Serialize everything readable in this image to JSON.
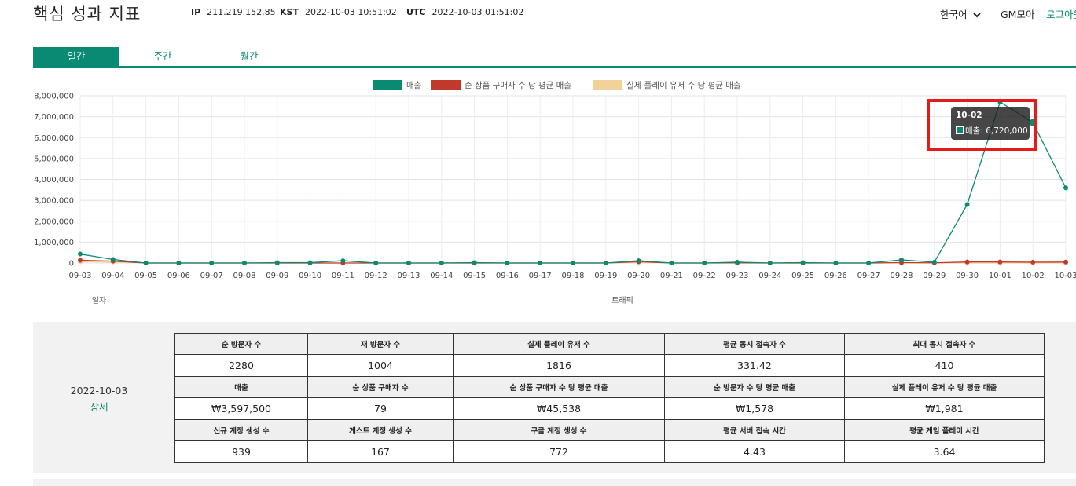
{
  "header": {
    "title": "핵심 성과 지표",
    "ip_label": "IP",
    "ip_value": "211.219.152.85",
    "kst_label": "KST",
    "kst_value": "2022-10-03 10:51:02",
    "utc_label": "UTC",
    "utc_value": "2022-10-03 01:51:02",
    "language": "한국어",
    "user": "GM모아",
    "logout": "로그아웃"
  },
  "tabs": [
    {
      "label": "일간",
      "active": true
    },
    {
      "label": "주간",
      "active": false
    },
    {
      "label": "월간",
      "active": false
    }
  ],
  "chart_data": {
    "type": "line",
    "x": [
      "09-03",
      "09-04",
      "09-05",
      "09-06",
      "09-07",
      "09-08",
      "09-09",
      "09-10",
      "09-11",
      "09-12",
      "09-13",
      "09-14",
      "09-15",
      "09-16",
      "09-17",
      "09-18",
      "09-19",
      "09-20",
      "09-21",
      "09-22",
      "09-23",
      "09-24",
      "09-25",
      "09-26",
      "09-27",
      "09-28",
      "09-29",
      "09-30",
      "10-01",
      "10-02",
      "10-03"
    ],
    "ylim": [
      0,
      8000000
    ],
    "yticks": [
      "0",
      "1,000,000",
      "2,000,000",
      "3,000,000",
      "4,000,000",
      "5,000,000",
      "6,000,000",
      "7,000,000",
      "8,000,000"
    ],
    "legend_position": "top-center",
    "grid": true,
    "series": [
      {
        "name": "매출",
        "color": "#0a8a73",
        "values": [
          430000,
          170000,
          0,
          0,
          0,
          0,
          20000,
          20000,
          110000,
          0,
          0,
          0,
          20000,
          0,
          0,
          0,
          0,
          110000,
          0,
          0,
          40000,
          0,
          20000,
          0,
          0,
          150000,
          40000,
          2800000,
          7700000,
          6720000,
          3597500
        ]
      },
      {
        "name": "순 상품 구매자 수 당 평균 매출",
        "color": "#c0392b",
        "values": [
          130000,
          90000,
          0,
          0,
          0,
          0,
          0,
          0,
          0,
          0,
          0,
          0,
          0,
          0,
          0,
          0,
          0,
          60000,
          0,
          0,
          10000,
          0,
          0,
          0,
          0,
          20000,
          10000,
          50000,
          50000,
          40000,
          45538
        ]
      },
      {
        "name": "실제 플레이 유저 수 당 평균 매출",
        "color": "#f2d29b",
        "values": [
          60000,
          50000,
          0,
          0,
          0,
          0,
          0,
          0,
          0,
          0,
          0,
          0,
          0,
          0,
          0,
          0,
          0,
          30000,
          0,
          0,
          0,
          0,
          0,
          0,
          0,
          0,
          0,
          0,
          0,
          0,
          1981
        ]
      }
    ],
    "tooltip": {
      "title": "10-02",
      "line": "매출: 6,720,000"
    },
    "footer_left": "일자",
    "footer_center": "트래픽"
  },
  "summary": {
    "date": "2022-10-03",
    "detail_link": "상세",
    "rows": [
      {
        "headers": [
          "순 방문자 수",
          "재 방문자 수",
          "실제 플레이 유저 수",
          "평균 동시 접속자 수",
          "최대 동시 접속자 수"
        ],
        "values": [
          "2280",
          "1004",
          "1816",
          "331.42",
          "410"
        ]
      },
      {
        "headers": [
          "매출",
          "순 상품 구매자 수",
          "순 상품 구매자 수 당 평균 매출",
          "순 방문자 수 당 평균 매출",
          "실제 플레이 유저 수 당 평균 매출"
        ],
        "values": [
          "₩3,597,500",
          "79",
          "₩45,538",
          "₩1,578",
          "₩1,981"
        ]
      },
      {
        "headers": [
          "신규 계정 생성 수",
          "게스트 계정 생성 수",
          "구글 계정 생성 수",
          "평균 서버 접속 시간",
          "평균 게임 플레이 시간"
        ],
        "values": [
          "939",
          "167",
          "772",
          "4.43",
          "3.64"
        ]
      }
    ]
  },
  "colors": {
    "accent": "#0a8a73",
    "highlight": "#e21b1b"
  }
}
